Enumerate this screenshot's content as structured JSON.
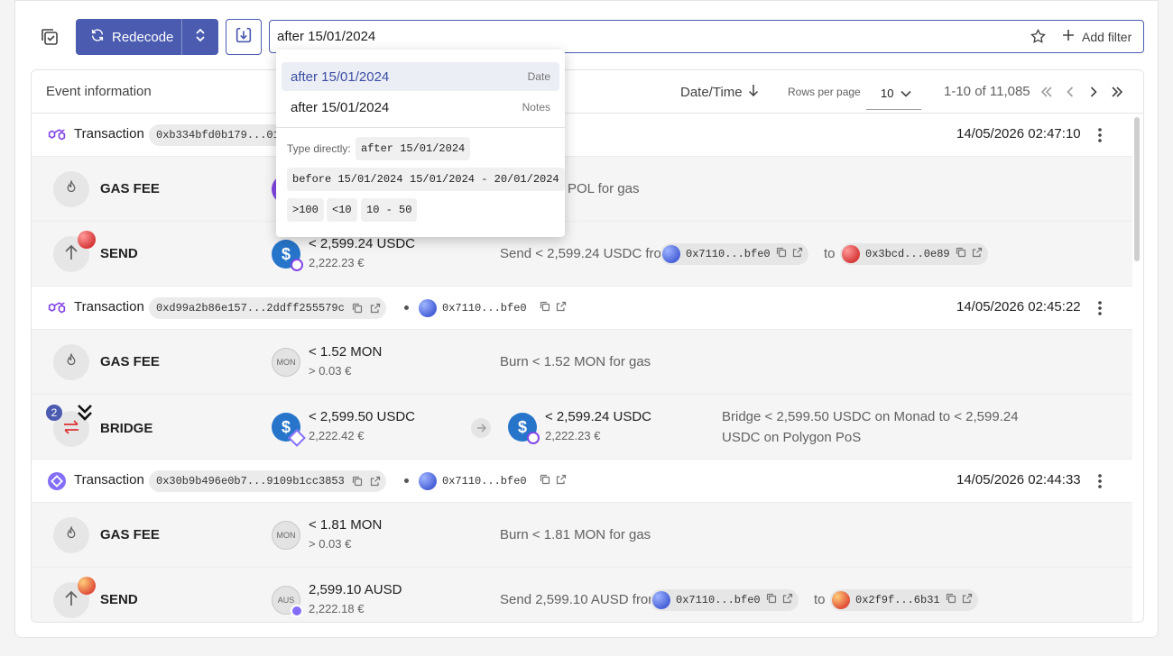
{
  "toolbar": {
    "redecode_label": "Redecode",
    "search_value": "after 15/01/2024",
    "add_filter_label": "Add filter"
  },
  "dropdown": {
    "options": [
      {
        "text": "after 15/01/2024",
        "kind": "Date"
      },
      {
        "text": "after 15/01/2024",
        "kind": "Notes"
      }
    ],
    "type_directly_label": "Type directly:",
    "chips": [
      "after 15/01/2024",
      "before 15/01/2024",
      "15/01/2024 - 20/01/2024",
      ">100",
      "<10",
      "10 - 50"
    ]
  },
  "table": {
    "col_event": "Event information",
    "col_date": "Date/Time",
    "rows_per_page_label": "Rows per page",
    "rows_per_page_value": "10",
    "range": "1-10 of 11,085"
  },
  "groups": [
    {
      "label": "Transaction",
      "hash": "0xb334bfd0b179...01",
      "time": "14/05/2026 02:47:10",
      "events": [
        {
          "name": "GAS FEE",
          "desc_tail": "POL for gas"
        },
        {
          "name": "SEND",
          "amount": "< 2,599.24 USDC",
          "fiat": "2,222.23 €",
          "desc_prefix": "Send < 2,599.24 USDC from",
          "from": "0x7110...bfe0",
          "to_word": "to",
          "to": "0x3bcd...0e89"
        }
      ]
    },
    {
      "label": "Transaction",
      "hash": "0xd99a2b86e157...2ddff255579c",
      "address": "0x7110...bfe0",
      "time": "14/05/2026 02:45:22",
      "events": [
        {
          "name": "GAS FEE",
          "token": "MON",
          "amount": "< 1.52 MON",
          "fiat": "> 0.03 €",
          "desc": "Burn < 1.52 MON for gas"
        },
        {
          "name": "BRIDGE",
          "badge": "2",
          "amount": "< 2,599.50 USDC",
          "fiat": "2,222.42 €",
          "amount2": "< 2,599.24 USDC",
          "fiat2": "2,222.23 €",
          "desc_line1": "Bridge < 2,599.50 USDC on Monad to < 2,599.24",
          "desc_line2": "USDC on Polygon PoS"
        }
      ]
    },
    {
      "label": "Transaction",
      "hash": "0x30b9b496e0b7...9109b1cc3853",
      "address": "0x7110...bfe0",
      "time": "14/05/2026 02:44:33",
      "events": [
        {
          "name": "GAS FEE",
          "token": "MON",
          "amount": "< 1.81 MON",
          "fiat": "> 0.03 €",
          "desc": "Burn < 1.81 MON for gas"
        },
        {
          "name": "SEND",
          "token": "AUS",
          "amount": "2,599.10 AUSD",
          "fiat": "2,222.18 €",
          "desc_prefix": "Send 2,599.10 AUSD from",
          "from": "0x7110...bfe0",
          "to_word": "to",
          "to": "0x2f9f...6b31"
        }
      ]
    }
  ],
  "colors": {
    "accent": "#4a5bb0",
    "polygon": "#8247e5",
    "usdc": "#2775ca",
    "monad": "#836ef9"
  }
}
